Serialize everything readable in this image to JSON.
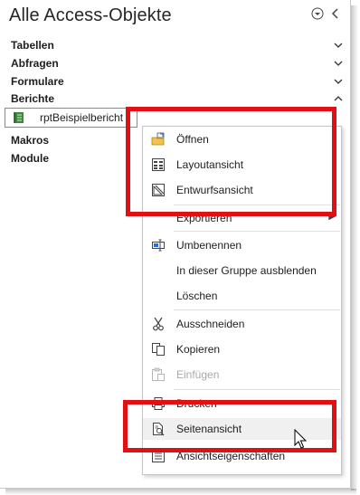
{
  "nav_pane": {
    "title": "Alle Access-Objekte",
    "menu_icon": "circle-chevron-down-icon",
    "collapse_icon": "chevron-left-icon"
  },
  "groups": [
    {
      "label": "Tabellen",
      "state": "collapsed"
    },
    {
      "label": "Abfragen",
      "state": "collapsed"
    },
    {
      "label": "Formulare",
      "state": "collapsed"
    },
    {
      "label": "Berichte",
      "state": "expanded"
    },
    {
      "label": "Makros",
      "state": "collapsed"
    },
    {
      "label": "Module",
      "state": "collapsed"
    }
  ],
  "selected_object": {
    "label": "rptBeispielbericht",
    "icon": "report-icon"
  },
  "context_menu": {
    "items": [
      {
        "label": "Öffnen",
        "icon": "open-report-icon",
        "enabled": true
      },
      {
        "label": "Layoutansicht",
        "icon": "layout-view-icon",
        "enabled": true
      },
      {
        "label": "Entwurfsansicht",
        "icon": "design-view-icon",
        "enabled": true
      },
      {
        "label": "Exportieren",
        "icon": "",
        "enabled": true,
        "submenu": true
      },
      {
        "label": "Umbenennen",
        "icon": "rename-icon",
        "enabled": true
      },
      {
        "label": "In dieser Gruppe ausblenden",
        "icon": "",
        "enabled": true
      },
      {
        "label": "Löschen",
        "icon": "",
        "enabled": true
      },
      {
        "label": "Ausschneiden",
        "icon": "scissors-icon",
        "enabled": true
      },
      {
        "label": "Kopieren",
        "icon": "copy-icon",
        "enabled": true
      },
      {
        "label": "Einfügen",
        "icon": "paste-icon",
        "enabled": false
      },
      {
        "label": "Drucken",
        "icon": "print-icon",
        "enabled": true
      },
      {
        "label": "Seitenansicht",
        "icon": "print-preview-icon",
        "enabled": true,
        "hovered": true
      },
      {
        "label": "Ansichtseigenschaften",
        "icon": "properties-icon",
        "enabled": true
      }
    ]
  },
  "colors": {
    "highlight": "#e01014",
    "report_icon": "#3a8a3a"
  }
}
